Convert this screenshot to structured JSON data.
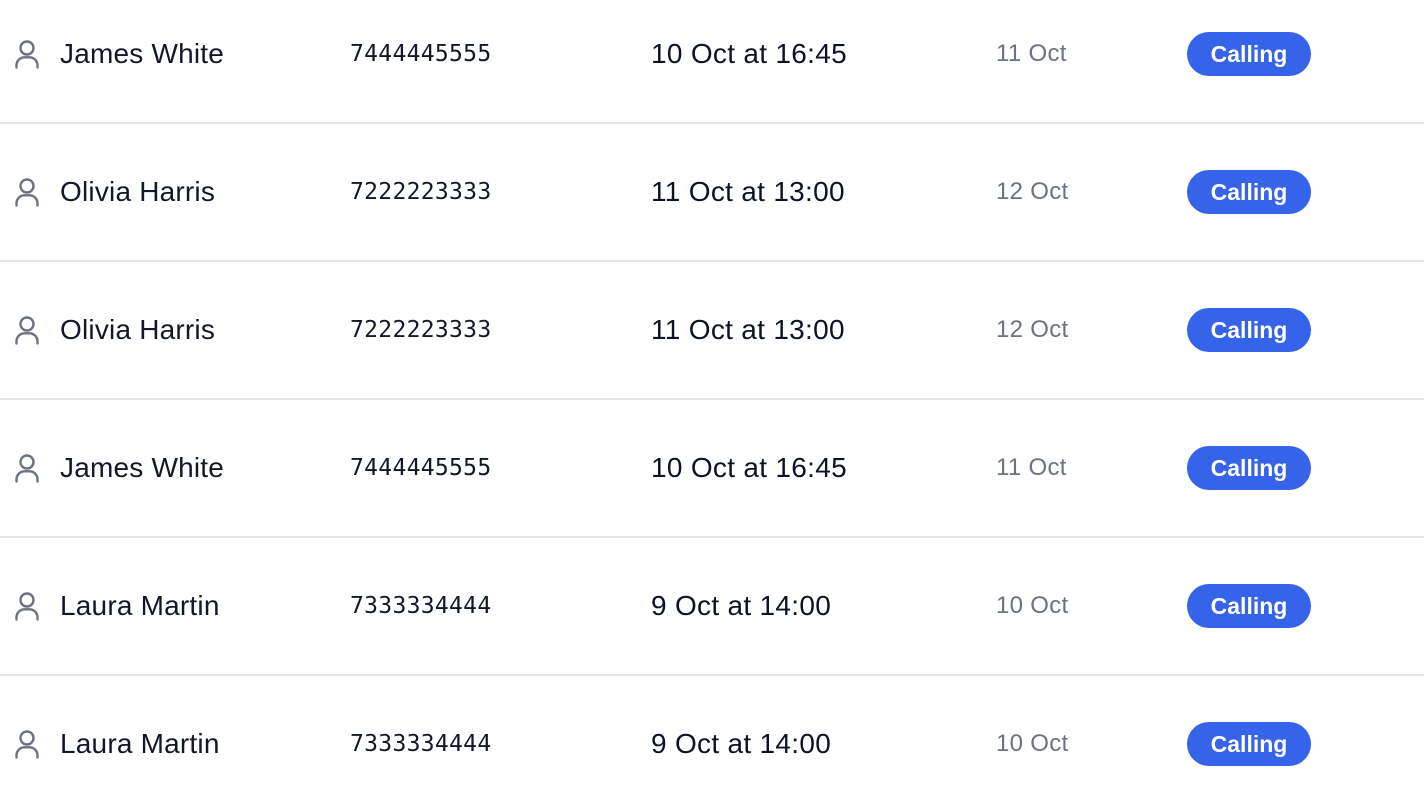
{
  "theme": {
    "status_color": "#3563e9",
    "icon_color": "#6b7280"
  },
  "rows": [
    {
      "icon": "user-icon",
      "name": "James White",
      "phone": "7444445555",
      "date": "10 Oct at 16:45",
      "next": "11 Oct",
      "status": "Calling"
    },
    {
      "icon": "user-icon",
      "name": "Olivia Harris",
      "phone": "7222223333",
      "date": "11 Oct at 13:00",
      "next": "12 Oct",
      "status": "Calling"
    },
    {
      "icon": "user-icon",
      "name": "Olivia Harris",
      "phone": "7222223333",
      "date": "11 Oct at 13:00",
      "next": "12 Oct",
      "status": "Calling"
    },
    {
      "icon": "user-icon",
      "name": "James White",
      "phone": "7444445555",
      "date": "10 Oct at 16:45",
      "next": "11 Oct",
      "status": "Calling"
    },
    {
      "icon": "user-icon",
      "name": "Laura Martin",
      "phone": "7333334444",
      "date": "9 Oct at 14:00",
      "next": "10 Oct",
      "status": "Calling"
    },
    {
      "icon": "user-icon",
      "name": "Laura Martin",
      "phone": "7333334444",
      "date": "9 Oct at 14:00",
      "next": "10 Oct",
      "status": "Calling"
    }
  ]
}
